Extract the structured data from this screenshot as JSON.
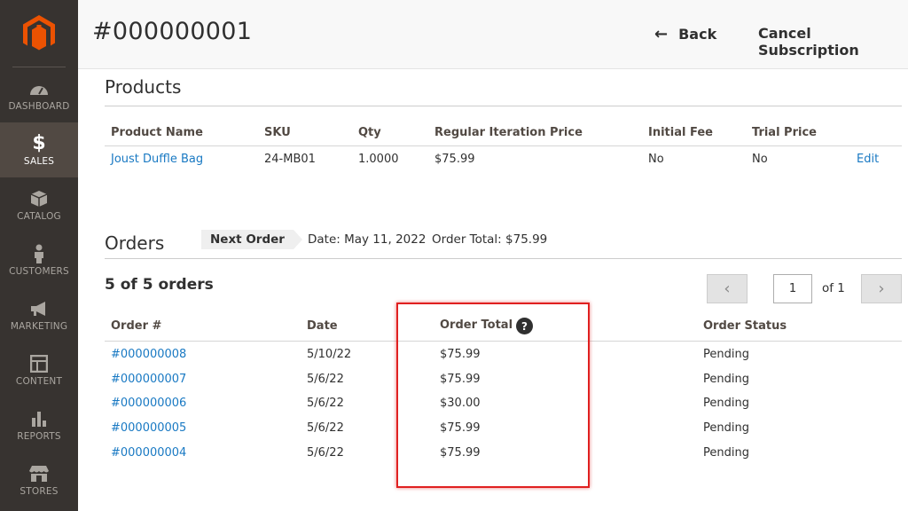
{
  "header": {
    "title": "#000000001",
    "back_label": "Back",
    "cancel_label": "Cancel Subscription"
  },
  "sidebar": {
    "items": [
      {
        "label": "DASHBOARD",
        "icon": "dashboard-icon"
      },
      {
        "label": "SALES",
        "icon": "dollar-icon",
        "active": true
      },
      {
        "label": "CATALOG",
        "icon": "box-icon"
      },
      {
        "label": "CUSTOMERS",
        "icon": "person-icon"
      },
      {
        "label": "MARKETING",
        "icon": "megaphone-icon"
      },
      {
        "label": "CONTENT",
        "icon": "layout-icon"
      },
      {
        "label": "REPORTS",
        "icon": "bar-chart-icon"
      },
      {
        "label": "STORES",
        "icon": "store-icon"
      }
    ]
  },
  "products": {
    "title": "Products",
    "columns": [
      "Product Name",
      "SKU",
      "Qty",
      "Regular Iteration Price",
      "Initial Fee",
      "Trial Price"
    ],
    "rows": [
      {
        "name": "Joust Duffle Bag",
        "sku": "24-MB01",
        "qty": "1.0000",
        "price": "$75.99",
        "initial_fee": "No",
        "trial_price": "No",
        "action": "Edit"
      }
    ]
  },
  "orders": {
    "title": "Orders",
    "next_order_label": "Next Order",
    "next_order_date": "Date: May 11, 2022",
    "next_order_total": "Order Total: $75.99",
    "count_label": "5 of 5 orders",
    "page": "1",
    "page_of": "of 1",
    "columns": [
      "Order #",
      "Date",
      "Order Total",
      "Order Status"
    ],
    "help_icon": "?",
    "rows": [
      {
        "order": "#000000008",
        "date": "5/10/22",
        "total": "$75.99",
        "status": "Pending"
      },
      {
        "order": "#000000007",
        "date": "5/6/22",
        "total": "$75.99",
        "status": "Pending"
      },
      {
        "order": "#000000006",
        "date": "5/6/22",
        "total": "$30.00",
        "status": "Pending"
      },
      {
        "order": "#000000005",
        "date": "5/6/22",
        "total": "$75.99",
        "status": "Pending"
      },
      {
        "order": "#000000004",
        "date": "5/6/22",
        "total": "$75.99",
        "status": "Pending"
      }
    ]
  },
  "colors": {
    "sidebar_bg": "#373330",
    "sidebar_active": "#514943",
    "logo_orange": "#eb5202",
    "link": "#1979c3",
    "highlight": "#e02020"
  }
}
